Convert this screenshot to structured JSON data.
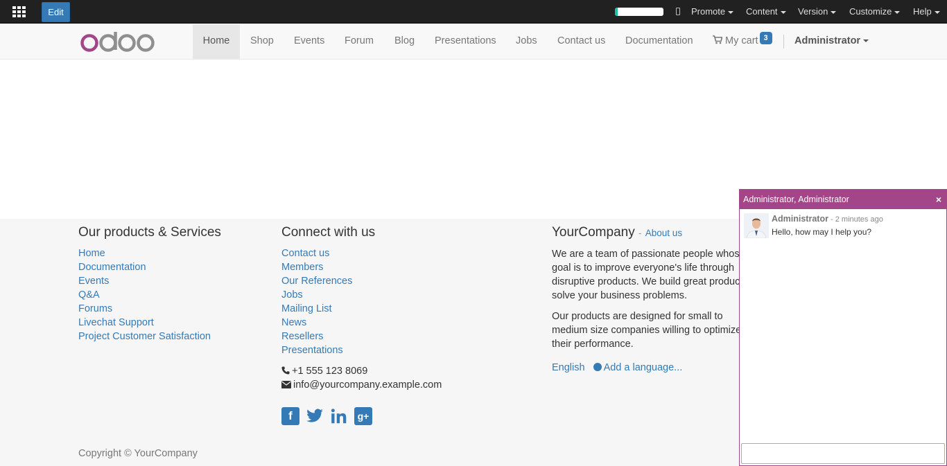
{
  "admin_bar": {
    "edit_label": "Edit",
    "progress_fraction": 0.05,
    "menus": [
      "Promote",
      "Content",
      "Version",
      "Customize",
      "Help"
    ]
  },
  "navbar": {
    "logo_text": "odoo",
    "items": [
      "Home",
      "Shop",
      "Events",
      "Forum",
      "Blog",
      "Presentations",
      "Jobs",
      "Contact us",
      "Documentation"
    ],
    "active_item": "Home",
    "cart_label": "My cart",
    "cart_count": "3",
    "user_label": "Administrator"
  },
  "footer": {
    "products": {
      "title": "Our products & Services",
      "links": [
        "Home",
        "Documentation",
        "Events",
        "Q&A",
        "Forums",
        "Livechat Support",
        "Project Customer Satisfaction"
      ]
    },
    "connect": {
      "title": "Connect with us",
      "links": [
        "Contact us",
        "Members",
        "Our References",
        "Jobs",
        "Mailing List",
        "News",
        "Resellers",
        "Presentations"
      ],
      "phone": "+1 555 123 8069",
      "email": "info@yourcompany.example.com"
    },
    "company": {
      "title": "YourCompany",
      "about_link": "About us",
      "para1": "We are a team of passionate people whose goal is to improve everyone's life through disruptive products. We build great products to solve your business problems.",
      "para2": "Our products are designed for small to medium size companies willing to optimize their performance.",
      "language": "English",
      "add_language": "Add a language..."
    },
    "copyright": "Copyright © YourCompany"
  },
  "chat": {
    "title": "Administrator, Administrator",
    "close_glyph": "×",
    "message": {
      "author": "Administrator",
      "time": " - 2 minutes ago",
      "text": "Hello, how may I help you?"
    },
    "input_placeholder": ""
  },
  "colors": {
    "admin_bar": "#212121",
    "primary": "#337ab7",
    "chat_header": "#a24689",
    "progress": "#1cc1a4"
  }
}
